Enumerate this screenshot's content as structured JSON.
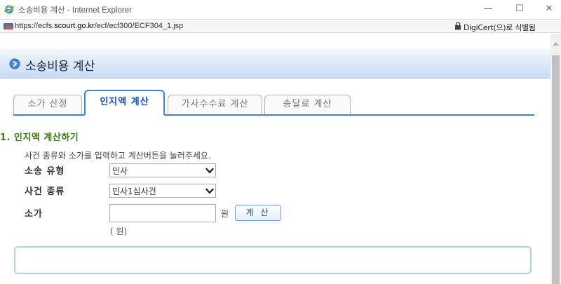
{
  "window": {
    "title": "소송비용 계산 - Internet Explorer",
    "min_label": "—",
    "max_label": "☐",
    "close_label": "✕"
  },
  "address": {
    "url_prefix": "https://ecfs.",
    "url_domain": "scourt.go.kr",
    "url_path": "/ecf/ecf300/ECF304_1.jsp",
    "cert": "DigiCert(으)로 식별됨"
  },
  "header": {
    "title": "소송비용 계산"
  },
  "tabs": [
    {
      "label": "소가 산정",
      "active": false
    },
    {
      "label": "인지액 계산",
      "active": true
    },
    {
      "label": "가사수수료 계산",
      "active": false
    },
    {
      "label": "송달료 계산",
      "active": false
    }
  ],
  "section": {
    "title": "1. 인지액 계산하기",
    "description": "사건 종류와 소가를 입력하고 계산버튼을 눌러주세요."
  },
  "form": {
    "lawsuit_type_label": "소송 유형",
    "lawsuit_type_value": "민사",
    "case_type_label": "사건 종류",
    "case_type_value": "민사1심사건",
    "amount_label": "소가",
    "amount_value": "",
    "amount_unit": "원",
    "calc_button": "계 산",
    "result_unit": "( 원)"
  },
  "colors": {
    "accent": "#3d84d6",
    "section_title": "#3d7a1a",
    "header_text": "#1d2c4f"
  }
}
